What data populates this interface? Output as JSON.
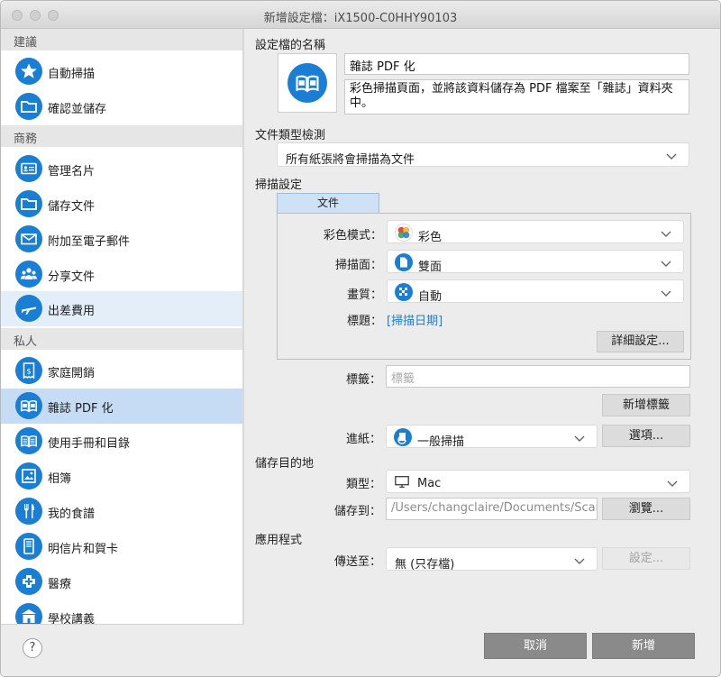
{
  "window": {
    "title": "新增設定檔：iX1500-C0HHY90103"
  },
  "sidebar": {
    "sections": [
      {
        "title": "建議",
        "items": [
          {
            "label": "自動掃描",
            "icon": "star-icon"
          },
          {
            "label": "確認並儲存",
            "icon": "folder-icon"
          }
        ]
      },
      {
        "title": "商務",
        "items": [
          {
            "label": "管理名片",
            "icon": "business-card-icon"
          },
          {
            "label": "儲存文件",
            "icon": "folder-icon"
          },
          {
            "label": "附加至電子郵件",
            "icon": "envelope-icon"
          },
          {
            "label": "分享文件",
            "icon": "people-icon"
          },
          {
            "label": "出差費用",
            "icon": "airplane-icon"
          }
        ]
      },
      {
        "title": "私人",
        "items": [
          {
            "label": "家庭開銷",
            "icon": "receipt-icon"
          },
          {
            "label": "雜誌 PDF 化",
            "icon": "open-book-icon"
          },
          {
            "label": "使用手冊和目錄",
            "icon": "manual-book-icon"
          },
          {
            "label": "相簿",
            "icon": "photo-album-icon"
          },
          {
            "label": "我的食譜",
            "icon": "fork-knife-icon"
          },
          {
            "label": "明信片和賀卡",
            "icon": "postcard-icon"
          },
          {
            "label": "醫療",
            "icon": "medical-icon"
          },
          {
            "label": "學校講義",
            "icon": "school-icon"
          }
        ]
      }
    ],
    "selected_item": "雜誌 PDF 化",
    "help_label": "?"
  },
  "profile": {
    "name_label": "設定檔的名稱",
    "name_value": "雜誌 PDF 化",
    "description_line1": "彩色掃描頁面，並將該資料儲存為 PDF 檔案至「雜誌」資料夾",
    "description_line2": "中。"
  },
  "doc_type": {
    "label": "文件類型檢測",
    "value": "所有紙張將會掃描為文件"
  },
  "scan_settings": {
    "label": "掃描設定",
    "tab_label": "文件",
    "color_mode_label": "彩色模式：",
    "color_mode_value": "彩色",
    "scan_side_label": "掃描面：",
    "scan_side_value": "雙面",
    "quality_label": "畫質：",
    "quality_value": "自動",
    "title_label": "標題：",
    "title_value": "[掃描日期]",
    "detail_button": "詳細設定..."
  },
  "tags": {
    "label": "標籤：",
    "placeholder": "標籤",
    "add_button": "新增標籤"
  },
  "feed": {
    "label": "進紙：",
    "value": "一般掃描",
    "options_button": "選項..."
  },
  "destination": {
    "label": "儲存目的地",
    "type_label": "類型：",
    "type_value": "Mac",
    "save_to_label": "儲存到：",
    "save_to_value": "/Users/changclaire/Documents/ScanSnap",
    "browse_button": "瀏覽..."
  },
  "application": {
    "label": "應用程式",
    "send_to_label": "傳送至：",
    "send_to_value": "無 (只存檔)",
    "settings_button": "設定..."
  },
  "footer": {
    "cancel_button": "取消",
    "add_button": "新增"
  },
  "colors": {
    "accent_blue": "#1a7fd4",
    "selected_bg": "#c6dcf5",
    "link_blue": "#1a7fd4"
  }
}
